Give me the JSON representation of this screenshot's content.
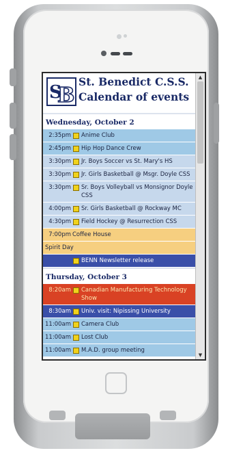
{
  "colors": {
    "header_text": "#1a2a66",
    "club": "#9fc9e6",
    "sport": "#c6d8ec",
    "special": "#f6cf80",
    "admin": "#3a4fa8",
    "alert": "#d94224"
  },
  "header": {
    "school_name": "St. Benedict C.S.S.",
    "subtitle": "Calendar of events",
    "logo_icon": "sb-logo-icon"
  },
  "days": [
    {
      "label": "Wednesday, October 2",
      "events": [
        {
          "time": "2:35pm",
          "title": "Anime Club",
          "category": "club",
          "icon": "event-icon"
        },
        {
          "time": "2:45pm",
          "title": "Hip Hop Dance Crew",
          "category": "club",
          "icon": "event-icon"
        },
        {
          "time": "3:30pm",
          "title": "Jr. Boys Soccer vs St. Mary's HS",
          "category": "sport",
          "icon": "event-icon"
        },
        {
          "time": "3:30pm",
          "title": "Jr. Girls Basketball @ Msgr. Doyle CSS",
          "category": "sport",
          "icon": "event-icon"
        },
        {
          "time": "3:30pm",
          "title": "Sr. Boys Volleyball vs Monsignor Doyle CSS",
          "category": "sport",
          "icon": "event-icon"
        },
        {
          "time": "4:00pm",
          "title": "Sr. Girls Basketball @ Rockway MC",
          "category": "sport",
          "icon": "event-icon"
        },
        {
          "time": "4:30pm",
          "title": "Field Hockey @ Resurrection CSS",
          "category": "sport",
          "icon": "event-icon"
        },
        {
          "time": "7:00pm",
          "title": "Coffee House",
          "category": "special",
          "icon": ""
        },
        {
          "time": "",
          "title": "Spirit Day",
          "category": "plain",
          "icon": ""
        },
        {
          "time": "",
          "title": "BENN Newsletter release",
          "category": "admin",
          "icon": "event-icon"
        }
      ]
    },
    {
      "label": "Thursday, October 3",
      "events": [
        {
          "time": "8:20am",
          "title": "Canadian Manufacturing Technology Show",
          "category": "alert",
          "icon": "event-icon"
        },
        {
          "time": "8:30am",
          "title": "Univ. visit: Nipissing University",
          "category": "admin",
          "icon": "event-icon"
        },
        {
          "time": "11:00am",
          "title": "Camera Club",
          "category": "club",
          "icon": "event-icon"
        },
        {
          "time": "11:00am",
          "title": "Lost Club",
          "category": "club",
          "icon": "event-icon"
        },
        {
          "time": "11:00am",
          "title": "M.A.D. group meeting",
          "category": "club",
          "icon": "event-icon"
        }
      ]
    }
  ],
  "scrollbar": {
    "up_arrow_icon": "scroll-up-arrow-icon",
    "down_arrow_icon": "scroll-down-arrow-icon"
  }
}
